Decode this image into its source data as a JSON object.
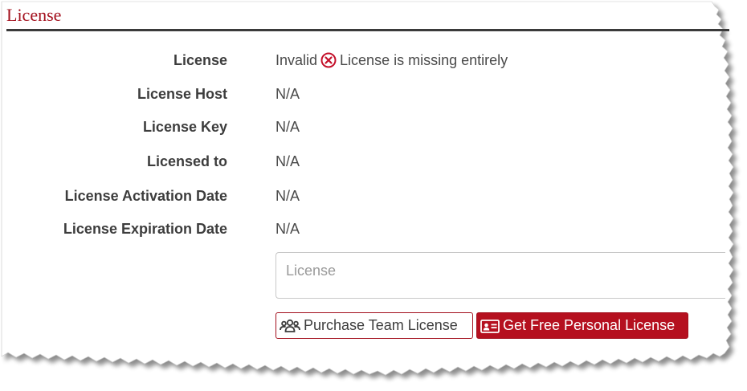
{
  "section": {
    "title": "License"
  },
  "fields": [
    {
      "label": "License",
      "value": "Invalid",
      "status_text": "License is missing entirely"
    },
    {
      "label": "License Host",
      "value": "N/A"
    },
    {
      "label": "License Key",
      "value": "N/A"
    },
    {
      "label": "Licensed to",
      "value": "N/A"
    },
    {
      "label": "License Activation Date",
      "value": "N/A"
    },
    {
      "label": "License Expiration Date",
      "value": "N/A"
    }
  ],
  "license_input": {
    "placeholder": "License",
    "value": ""
  },
  "buttons": {
    "purchase_team": {
      "label": "Purchase Team License",
      "icon": "users-icon"
    },
    "free_personal": {
      "label": "Get Free Personal License",
      "icon": "id-card-icon"
    }
  },
  "colors": {
    "accent": "#a3101d",
    "button_fill": "#b5101f",
    "error": "#c4102a",
    "label_text": "#3d3d3d",
    "rule": "#3a3a3a"
  }
}
